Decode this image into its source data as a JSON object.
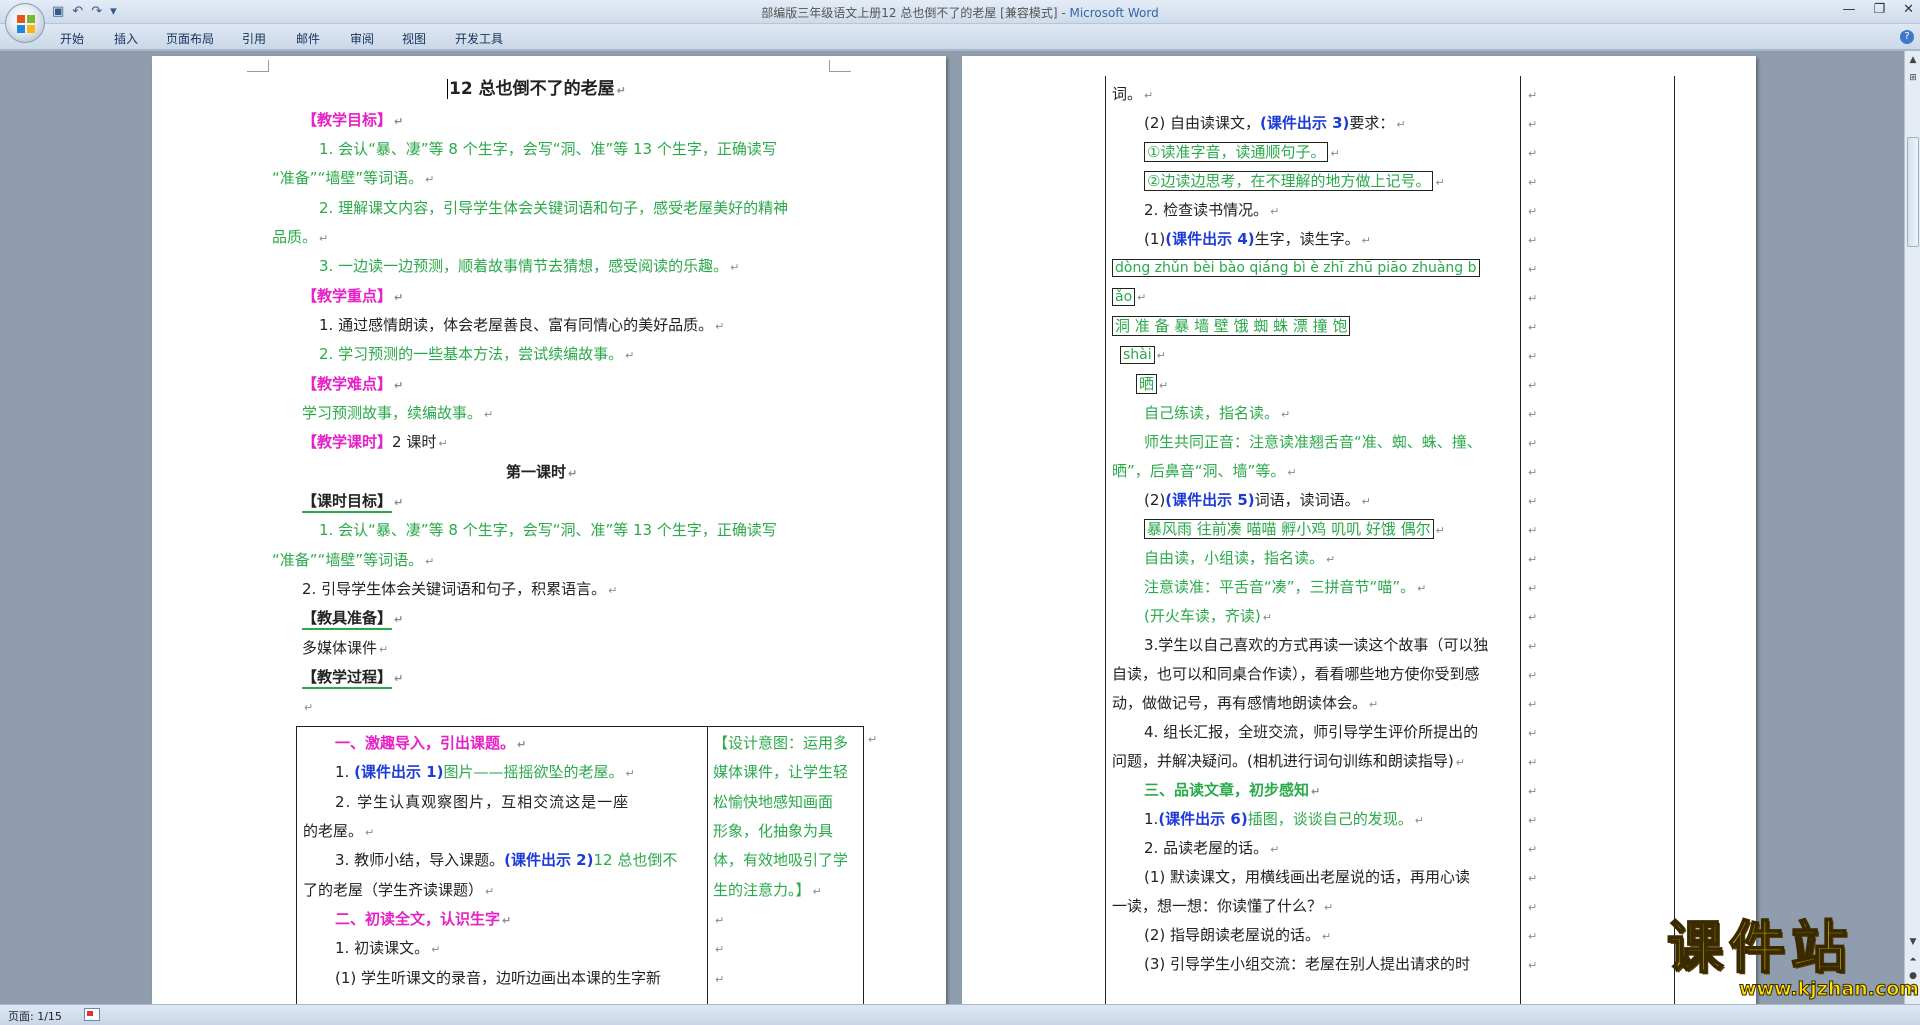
{
  "window": {
    "title_doc": "部编版三年级语文上册12 总也倒不了的老屋 [兼容模式] - ",
    "title_app": "Microsoft Word",
    "controls": {
      "minimize": "—",
      "restore": "❐",
      "close": "✕"
    }
  },
  "qat": {
    "save_icon": "save-icon",
    "undo_icon": "undo-icon",
    "redo_icon": "redo-icon",
    "customize_icon": "customize-icon"
  },
  "ribbon_tabs": [
    "开始",
    "插入",
    "页面布局",
    "引用",
    "邮件",
    "审阅",
    "视图",
    "开发工具"
  ],
  "status": {
    "page": "页面: 1/15"
  },
  "watermark": {
    "main": "课件站",
    "url": "www.kjzhan.com"
  },
  "colors": {
    "green": "#2aaa4a",
    "magenta": "#e620c8",
    "blue": "#1d3bd8",
    "ribbon": "#cfdbea"
  },
  "page1": {
    "title": "12 总也倒不了的老屋",
    "h_goal": "【教学目标】",
    "goal1a": "1. 会认“暴、凄”等 8 个生字，会写“洞、准”等 13 个生字，正确读写",
    "goal1b": "“准备”“墙壁”等词语。",
    "goal2a": "2. 理解课文内容，引导学生体会关键词语和句子，感受老屋美好的精神",
    "goal2b": "品质。",
    "goal3": "3. 一边读一边预测，顺着故事情节去猜想，感受阅读的乐趣。",
    "h_key": "【教学重点】",
    "key1": "1. 通过感情朗读，体会老屋善良、富有同情心的美好品质。",
    "key2": "2. 学习预测的一些基本方法，尝试续编故事。",
    "h_diff": "【教学难点】",
    "diff": "学习预测故事，续编故事。",
    "h_hours": "【教学课时】",
    "hours": "2 课时",
    "lesson": "第一课时",
    "h_lgoal": "【课时目标】",
    "lgoal1a": "1. 会认“暴、凄”等 8 个生字，会写“洞、准”等 13 个生字，正确读写",
    "lgoal1b": "“准备”“墙壁”等词语。",
    "lgoal2": "2. 引导学生体会关键词语和句子，积累语言。",
    "h_tools": "【教具准备】",
    "tools": "多媒体课件",
    "h_process": "【教学过程】",
    "t_sec1": "一、激趣导入，引出课题。",
    "t_s1a_pre": "1. ",
    "t_s1a_ref": "(课件出示 1)",
    "t_s1a_post": "图片——摇摇欲坠的老屋。",
    "t_s1b_a": "2. 学生认真观察图片，互相交流这是一座",
    "t_s1b_b": "的老屋。",
    "t_s1c_pre": "3. 教师小结，导入课题。",
    "t_s1c_ref": "(课件出示 2)",
    "t_s1c_post": "12 总也倒不",
    "t_s1c_b": "了的老屋（学生齐读课题）",
    "t_sec2": "二、初读全文，认识生字",
    "t_s2a": "1. 初读课文。",
    "t_s2b": "(1) 学生听课文的录音，边听边画出本课的生字新",
    "design1": "【设计意图：运用多",
    "design2": "媒体课件，让学生轻",
    "design3": "松愉快地感知画面",
    "design4": "形象，化抽象为具",
    "design5": "体，有效地吸引了学",
    "design6": "生的注意力。】"
  },
  "page2": {
    "p0": "词。",
    "p1_pre": "(2) 自由读课文，",
    "p1_ref": "(课件出示 3)",
    "p1_post": "要求：",
    "p2": "①读准字音，读通顺句子。",
    "p3": "②边读边思考，在不理解的地方做上记号。",
    "p4": "2. 检查读书情况。",
    "p5_pre": "(1)",
    "p5_ref": "(课件出示 4)",
    "p5_post": "生字，读生字。",
    "pinyin1": "dòng zhǔn bèi bào qiáng bì è zhī zhū piāo zhuàng b",
    "pinyin2": "ǎo",
    "hanzi": "洞    准   备   暴    墙 壁 饿 蜘 蛛   漂     撞    饱",
    "pinyin3": "shài",
    "hanzi2": "晒",
    "p6": "自己练读，指名读。",
    "p7a": "师生共同正音：注意读准翘舌音“准、蜘、蛛、撞、",
    "p7b": "晒”，后鼻音“洞、墙”等。",
    "p8_pre": "(2)",
    "p8_ref": "(课件出示 5)",
    "p8_post": "词语，读词语。",
    "p9": "暴风雨 往前凑 喵喵 孵小鸡 叽叽 好饿 偶尔",
    "p10": "自由读，小组读，指名读。",
    "p11": "注意读准：平舌音“凑”，三拼音节“喵”。",
    "p12": "(开火车读，齐读)",
    "p13a": "3.学生以自己喜欢的方式再读一读这个故事（可以独",
    "p13b": "自读，也可以和同桌合作读），看看哪些地方使你受到感",
    "p13c": "动，做做记号，再有感情地朗读体会。",
    "p14a": "4. 组长汇报，全班交流，师引导学生评价所提出的",
    "p14b": "问题，并解决疑问。(相机进行词句训练和朗读指导)",
    "p15": "三、品读文章，初步感知",
    "p16_pre": "1.",
    "p16_ref": "(课件出示 6)",
    "p16_post": "插图，谈谈自己的发现。",
    "p17": "2. 品读老屋的话。",
    "p18a": "(1) 默读课文，用横线画出老屋说的话，再用心读",
    "p18b": "一读，想一想：你读懂了什么？",
    "p19": "(2) 指导朗读老屋说的话。",
    "p20": "(3) 引导学生小组交流：老屋在别人提出请求的时"
  }
}
